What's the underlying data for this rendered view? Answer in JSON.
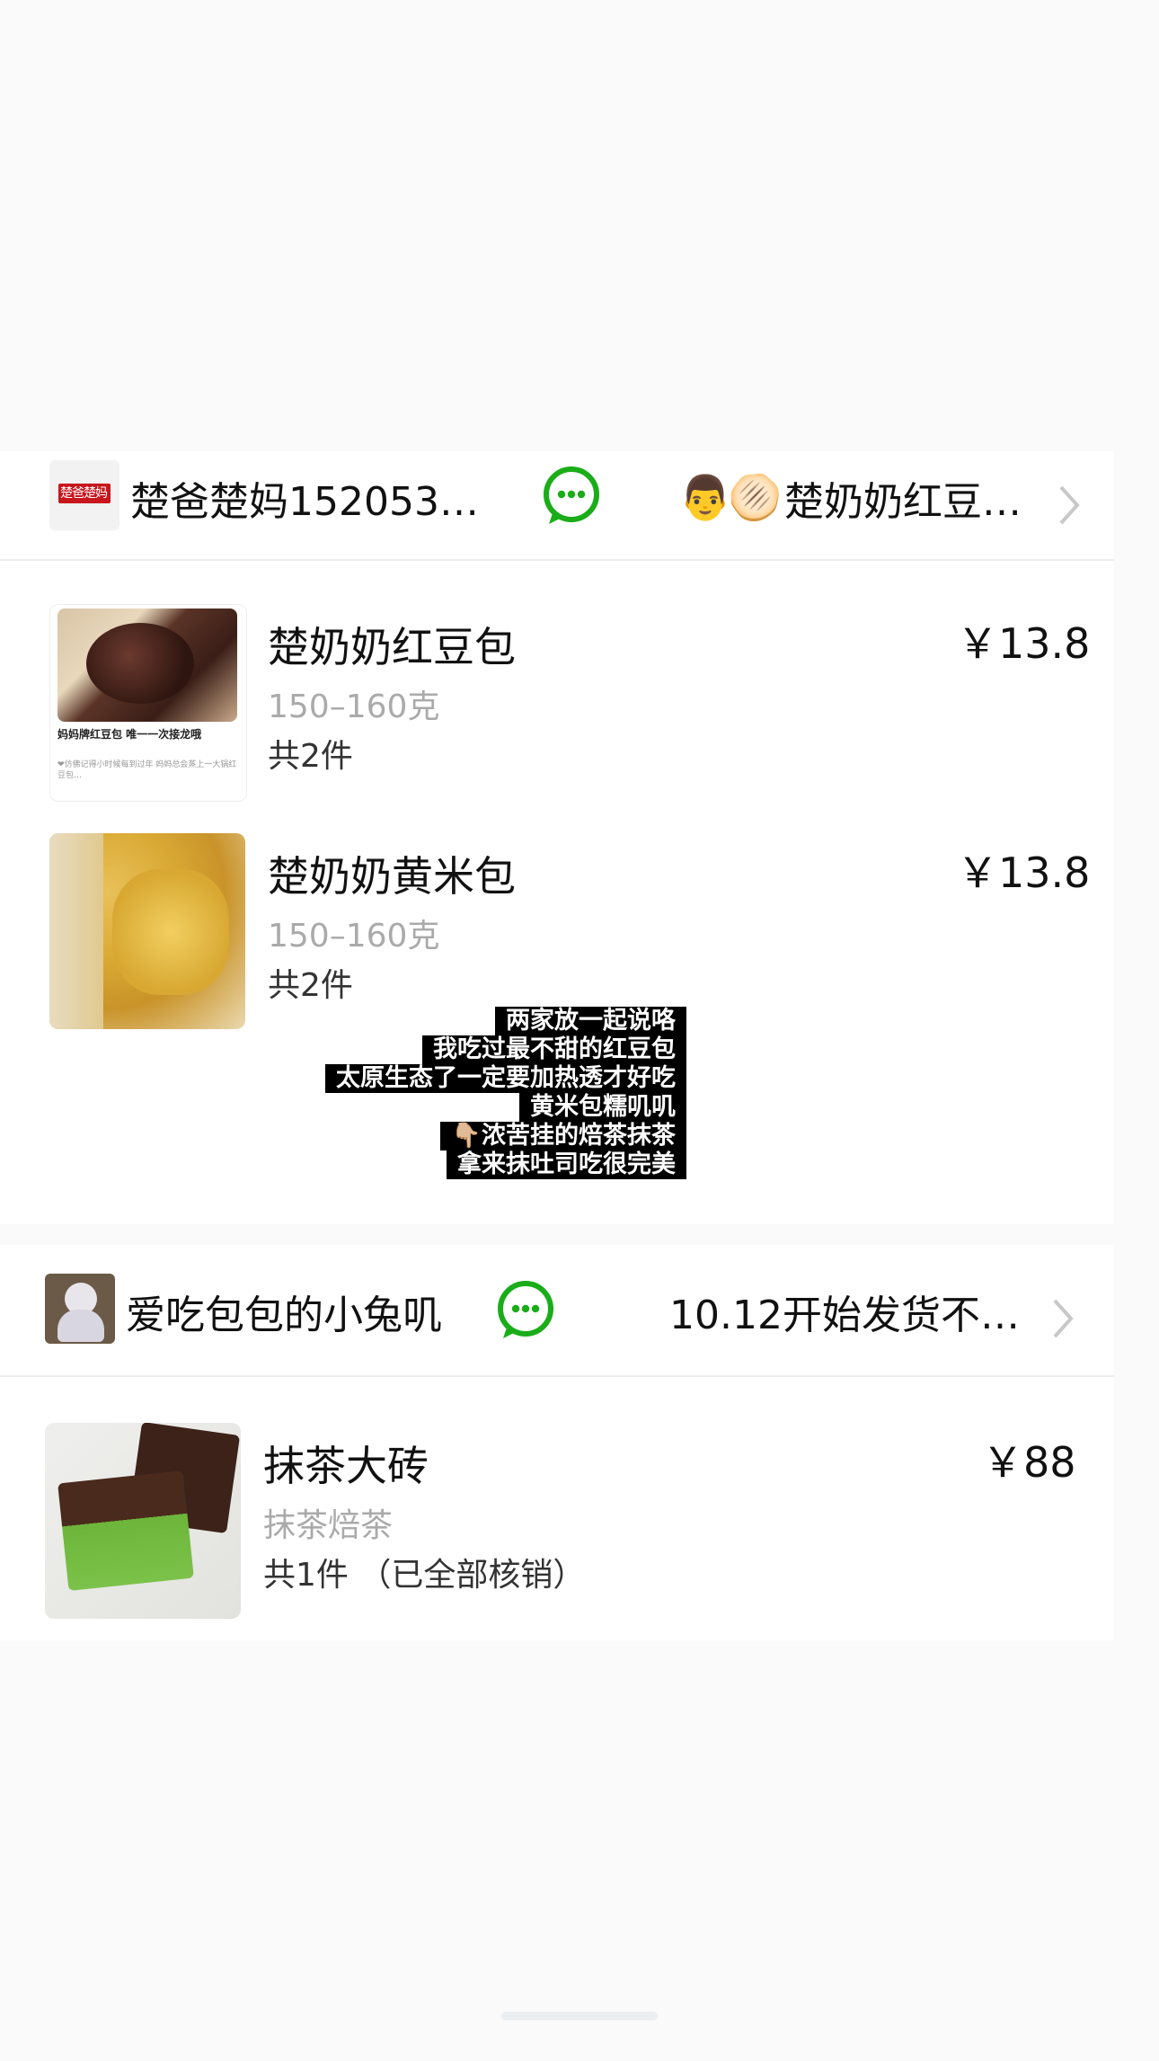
{
  "orders": [
    {
      "shop_name": "楚爸楚妈152053…",
      "logo_text": "楚爸楚妈",
      "note": "楚奶奶红豆…",
      "note_emojis": [
        "👨",
        "🫓"
      ],
      "items": [
        {
          "title": "楚奶奶红豆包",
          "spec": "150–160克",
          "qty": "共2件",
          "price": "￥13.8",
          "thumb_caption": "妈妈牌红豆包 唯一一次接龙哦",
          "thumb_subcaption": "❤仿佛记得小时候每到过年 妈妈总会蒸上一大锅红豆包…"
        },
        {
          "title": "楚奶奶黄米包",
          "spec": "150–160克",
          "qty": "共2件",
          "price": "￥13.8"
        }
      ]
    },
    {
      "shop_name": "爱吃包包的小兔叽",
      "note": "10.12开始发货不…",
      "items": [
        {
          "title": "抹茶大砖",
          "spec": "抹茶焙茶",
          "qty": "共1件 （已全部核销）",
          "price": "￥88"
        }
      ]
    }
  ],
  "caption_lines": [
    "两家放一起说咯",
    "我吃过最不甜的红豆包",
    "太原生态了一定要加热透才好吃",
    "黄米包糯叽叽",
    "👇🏼浓苦挂的焙茶抹茶",
    "拿来抹吐司吃很完美"
  ],
  "colors": {
    "wechat_green": "#1aad19",
    "price": "#111111",
    "spec": "#aaaaaa"
  }
}
